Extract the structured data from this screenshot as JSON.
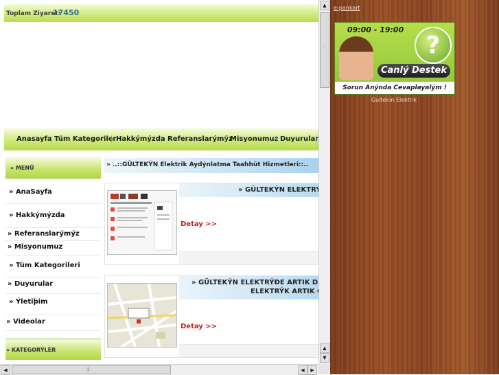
{
  "stats": {
    "visits_label": "Toplam Ziyaret:",
    "visits_count": "17450"
  },
  "nav": {
    "items": [
      "Anasayfa",
      "Tüm Kategoriler",
      "Hakkýmýzda",
      "Referanslarýmýz",
      "Misyonumuz",
      "Duyurular"
    ],
    "separator": "|"
  },
  "menu": {
    "header": "» MENÜ",
    "items": [
      "» AnaSayfa",
      "» Hakkýmýzda",
      "» Referanslarýmýz",
      "» Misyonumuz",
      "» Tüm Kategorileri",
      "» Duyurular",
      "» Ýletiþim",
      "» Videolar"
    ],
    "categories_header": "» KATEGORÝLER"
  },
  "main": {
    "header": "» ..::GÜLTEKÝN Elektrik Aydýnlatma Taahhüt Hizmetleri::..",
    "news": [
      {
        "title_lines": [
          "» GÜLTEKÝN ELEKTRÝK"
        ],
        "detail": "Detay >>"
      },
      {
        "title_lines": [
          "» GÜLTEKÝN ELEKTRÝÐE ARTIK DAH",
          "ELEKTRÝK ARTIK G"
        ],
        "detail": "Detay >>"
      }
    ]
  },
  "side": {
    "epankart": "e-pankart",
    "banner": {
      "hours": "09:00 - 19:00",
      "title": "Canlý Destek",
      "subtitle": "Sorun Anýnda Cevaplayalým !"
    },
    "company": "Gultekin Elektrik"
  },
  "scrollbars": {
    "up": "▲",
    "down": "▼",
    "left": "◀",
    "right": "▶"
  },
  "colors": {
    "nav_green": "#cfe97a",
    "blue_header": "#c9e2f2",
    "detail_red": "#c0221f",
    "wood": "#9a4f26"
  }
}
